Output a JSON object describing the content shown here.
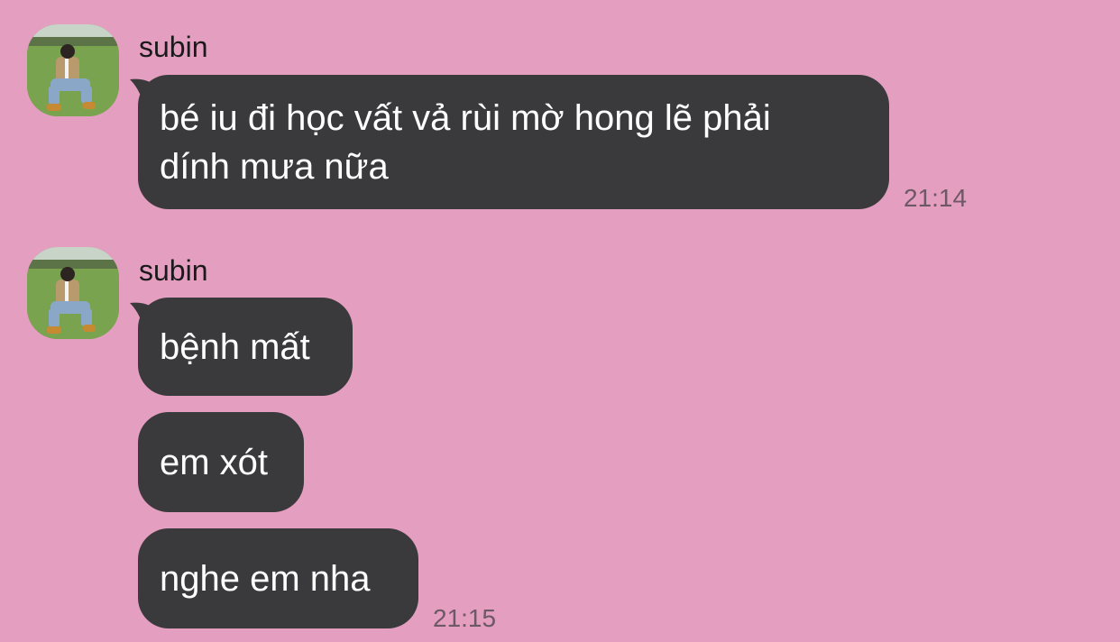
{
  "chat": {
    "messages": [
      {
        "sender": "subin",
        "bubbles": [
          "bé iu đi học vất vả rùi mờ hong lẽ phải\ndính mưa nữa"
        ],
        "time": "21:14"
      },
      {
        "sender": "subin",
        "bubbles": [
          "bệnh mất",
          "em xót",
          "nghe em nha"
        ],
        "time": "21:15"
      }
    ]
  },
  "theme": {
    "background": "#e49ec0",
    "bubble": "#3a3a3c",
    "bubble_text": "#ffffff",
    "timestamp": "#6d5866"
  },
  "icons": {
    "avatar": "profile-photo-avatar"
  }
}
